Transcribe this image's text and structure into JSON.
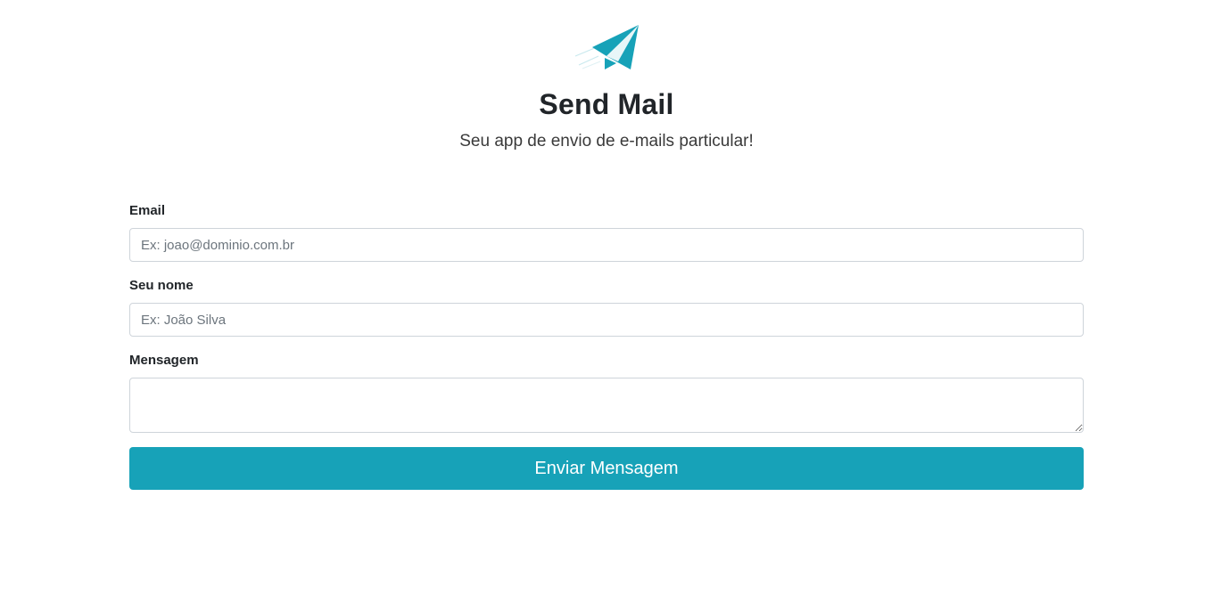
{
  "header": {
    "logo_icon": "paper-plane-icon",
    "title": "Send Mail",
    "subtitle": "Seu app de envio de e-mails particular!"
  },
  "form": {
    "email": {
      "label": "Email",
      "placeholder": "Ex: joao@dominio.com.br",
      "value": ""
    },
    "name": {
      "label": "Seu nome",
      "placeholder": "Ex: João Silva",
      "value": ""
    },
    "message": {
      "label": "Mensagem",
      "placeholder": "",
      "value": ""
    },
    "submit_label": "Enviar Mensagem"
  },
  "colors": {
    "accent": "#17a2b8",
    "text": "#212529",
    "border": "#ced4da"
  }
}
